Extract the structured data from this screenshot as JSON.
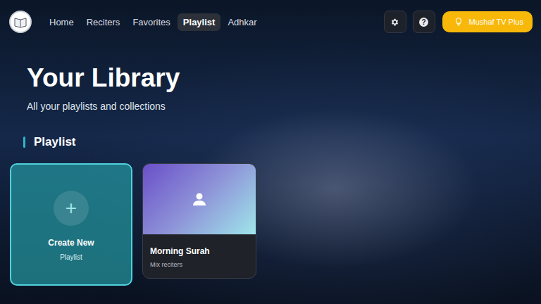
{
  "nav": {
    "items": [
      {
        "label": "Home",
        "selected": false
      },
      {
        "label": "Reciters",
        "selected": false
      },
      {
        "label": "Favorites",
        "selected": false
      },
      {
        "label": "Playlist",
        "selected": true
      },
      {
        "label": "Adhkar",
        "selected": false
      }
    ],
    "help_icon": "?",
    "premium": {
      "label": "Mushaf TV Plus"
    }
  },
  "hero": {
    "title": "Your Library",
    "subtitle": "All your playlists and collections"
  },
  "section": {
    "title": "Playlist"
  },
  "cards": [
    {
      "kind": "create",
      "icon": "+",
      "title": "Create New",
      "subtitle": "Playlist",
      "selected": true
    },
    {
      "kind": "playlist",
      "title": "Morning Surah",
      "subtitle": "Mix reciters",
      "selected": false
    }
  ]
}
